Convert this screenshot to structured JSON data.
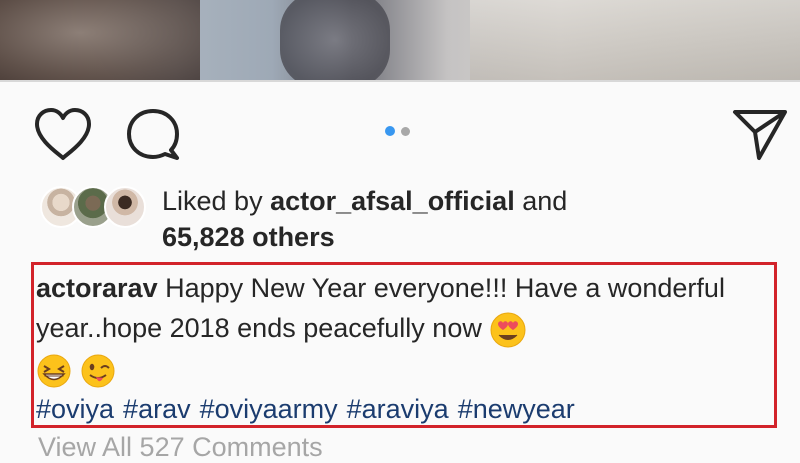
{
  "post": {
    "actions": {
      "like_icon": "heart-outline",
      "comment_icon": "speech-bubble-outline",
      "share_icon": "paper-plane-outline"
    },
    "carousel": {
      "current": 1,
      "total": 2,
      "active_color": "#3897f0"
    },
    "likes": {
      "prefix": "Liked by",
      "user": "actor_afsal_official",
      "connector": "and",
      "others": "65,828 others"
    },
    "caption": {
      "username": "actorarav",
      "text": "Happy New Year everyone!!! Have a wonderful year..hope 2018 ends peacefully now",
      "emojis": [
        "smiling-face-with-heart-eyes",
        "grinning-squinting-face",
        "winking-face-with-tongue"
      ],
      "hashtags": [
        "#oviya",
        "#arav",
        "#oviyaarmy",
        "#araviya",
        "#newyear"
      ]
    },
    "comments_link": "View All 527 Comments",
    "highlight_color": "#d2232a"
  }
}
